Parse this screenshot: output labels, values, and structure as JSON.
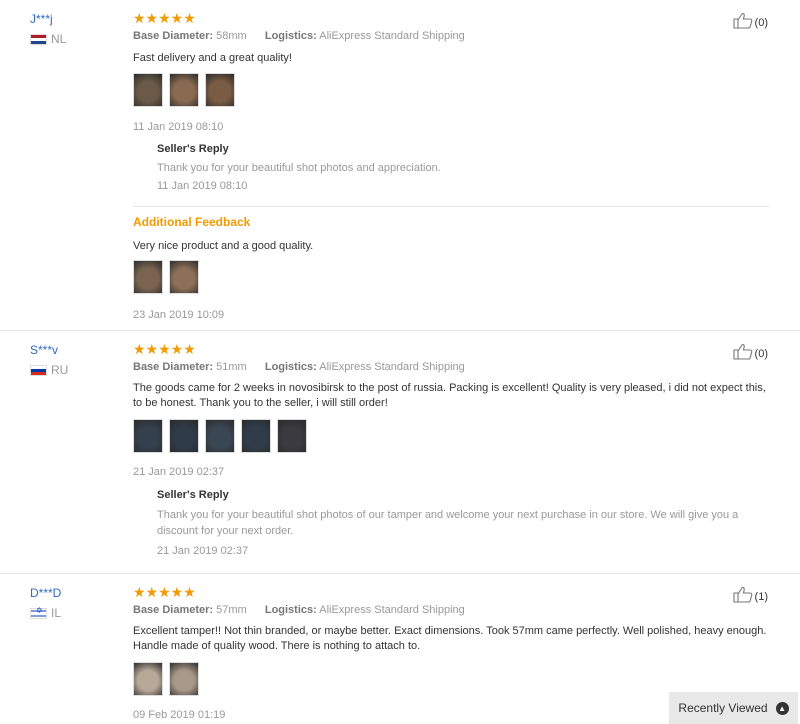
{
  "reviews": [
    {
      "user": "J***j",
      "country": "NL",
      "stars": "★★★★★",
      "base_diameter_label": "Base Diameter:",
      "base_diameter": "58mm",
      "logistics_label": "Logistics:",
      "logistics": "AliExpress Standard Shipping",
      "text": "Fast delivery and a great quality!",
      "date": "11 Jan 2019 08:10",
      "helpful": "(0)",
      "photo_colors": [
        "#6b5a48",
        "#8a6a50",
        "#7a5c44"
      ],
      "reply_title": "Seller's Reply",
      "reply_text": "Thank you for your beautiful shot photos and appreciation.",
      "reply_date": "11 Jan 2019 08:10",
      "additional_title": "Additional Feedback",
      "additional_text": "Very nice product and a good quality.",
      "additional_photo_colors": [
        "#7a6450",
        "#8c7058"
      ],
      "additional_date": "23 Jan 2019 10:09"
    },
    {
      "user": "S***v",
      "country": "RU",
      "stars": "★★★★★",
      "base_diameter_label": "Base Diameter:",
      "base_diameter": "51mm",
      "logistics_label": "Logistics:",
      "logistics": "AliExpress Standard Shipping",
      "text": "The goods came for 2 weeks in novosibirsk to the post of russia. Packing is excellent! Quality is very pleased, i did not expect this, to be honest. Thank you to the seller, i will still order!",
      "date": "21 Jan 2019 02:37",
      "helpful": "(0)",
      "photo_colors": [
        "#34404e",
        "#2e3a48",
        "#3a4654",
        "#303c4a",
        "#3a3a40"
      ],
      "reply_title": "Seller's Reply",
      "reply_text": "Thank you for your beautiful shot photos of our tamper and welcome your next purchase in our store. We will give you a discount for your next order.",
      "reply_date": "21 Jan 2019 02:37"
    },
    {
      "user": "D***D",
      "country": "IL",
      "stars": "★★★★★",
      "base_diameter_label": "Base Diameter:",
      "base_diameter": "57mm",
      "logistics_label": "Logistics:",
      "logistics": "AliExpress Standard Shipping",
      "text": "Excellent tamper!! Not thin branded, or maybe better. Exact dimensions. Took 57mm came perfectly. Well polished, heavy enough. Handle made of quality wood. There is nothing to attach to.",
      "date": "09 Feb 2019 01:19",
      "helpful": "(1)",
      "photo_colors": [
        "#b8a898",
        "#a89888"
      ]
    }
  ],
  "recently_viewed": {
    "label": "Recently Viewed"
  }
}
